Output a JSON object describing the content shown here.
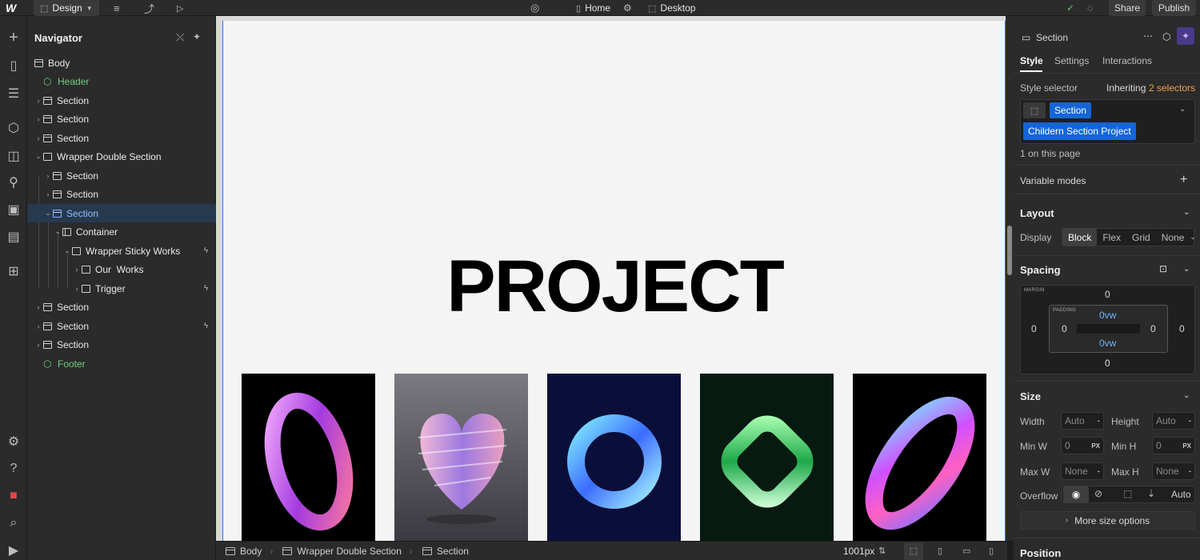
{
  "topbar": {
    "logo": "W",
    "mode_label": "Design",
    "page_name": "Home",
    "breakpoint_label": "Desktop",
    "share_label": "Share",
    "publish_label": "Publish"
  },
  "navigator": {
    "title": "Navigator",
    "items": [
      {
        "label": "Body"
      },
      {
        "label": "Header"
      },
      {
        "label": "Section"
      },
      {
        "label": "Section"
      },
      {
        "label": "Section"
      },
      {
        "label": "Wrapper Double Section"
      },
      {
        "label": "Section"
      },
      {
        "label": "Section"
      },
      {
        "label": "Section"
      },
      {
        "label": "Container"
      },
      {
        "label": "Wrapper Sticky Works"
      },
      {
        "label": "Our  Works"
      },
      {
        "label": "Trigger"
      },
      {
        "label": "Section"
      },
      {
        "label": "Section"
      },
      {
        "label": "Section"
      },
      {
        "label": "Footer"
      }
    ]
  },
  "canvas": {
    "heading": "PROJECT"
  },
  "bottombar": {
    "crumbs": [
      "Body",
      "Wrapper Double Section",
      "Section"
    ],
    "width_readout": "1001px"
  },
  "right_panel": {
    "element_label": "Section",
    "tabs": [
      "Style",
      "Settings",
      "Interactions"
    ],
    "style_selector_label": "Style selector",
    "inheriting_label": "Inheriting",
    "inheriting_count": "2 selectors",
    "selector_chip_1": "Section",
    "selector_chip_2": "Childern Section Project",
    "on_page_count": "1 on this page",
    "variable_modes_label": "Variable modes",
    "layout_heading": "Layout",
    "display_label": "Display",
    "display_options": [
      "Block",
      "Flex",
      "Grid",
      "None"
    ],
    "spacing_heading": "Spacing",
    "margin_label": "MARGIN",
    "padding_label": "PADDING",
    "margin": {
      "top": "0",
      "right": "0",
      "bottom": "0",
      "left": "0"
    },
    "padding": {
      "top": "0vw",
      "right": "0",
      "bottom": "0vw",
      "left": "0"
    },
    "size_heading": "Size",
    "width_label": "Width",
    "width_value": "Auto",
    "height_label": "Height",
    "height_value": "Auto",
    "minw_label": "Min W",
    "minw_value": "0",
    "minh_label": "Min H",
    "minh_value": "0",
    "maxw_label": "Max W",
    "maxw_value": "None",
    "maxh_label": "Max H",
    "maxh_value": "None",
    "unit_px": "PX",
    "overflow_label": "Overflow",
    "overflow_auto": "Auto",
    "more_size_label": "More size options",
    "position_heading": "Position"
  }
}
